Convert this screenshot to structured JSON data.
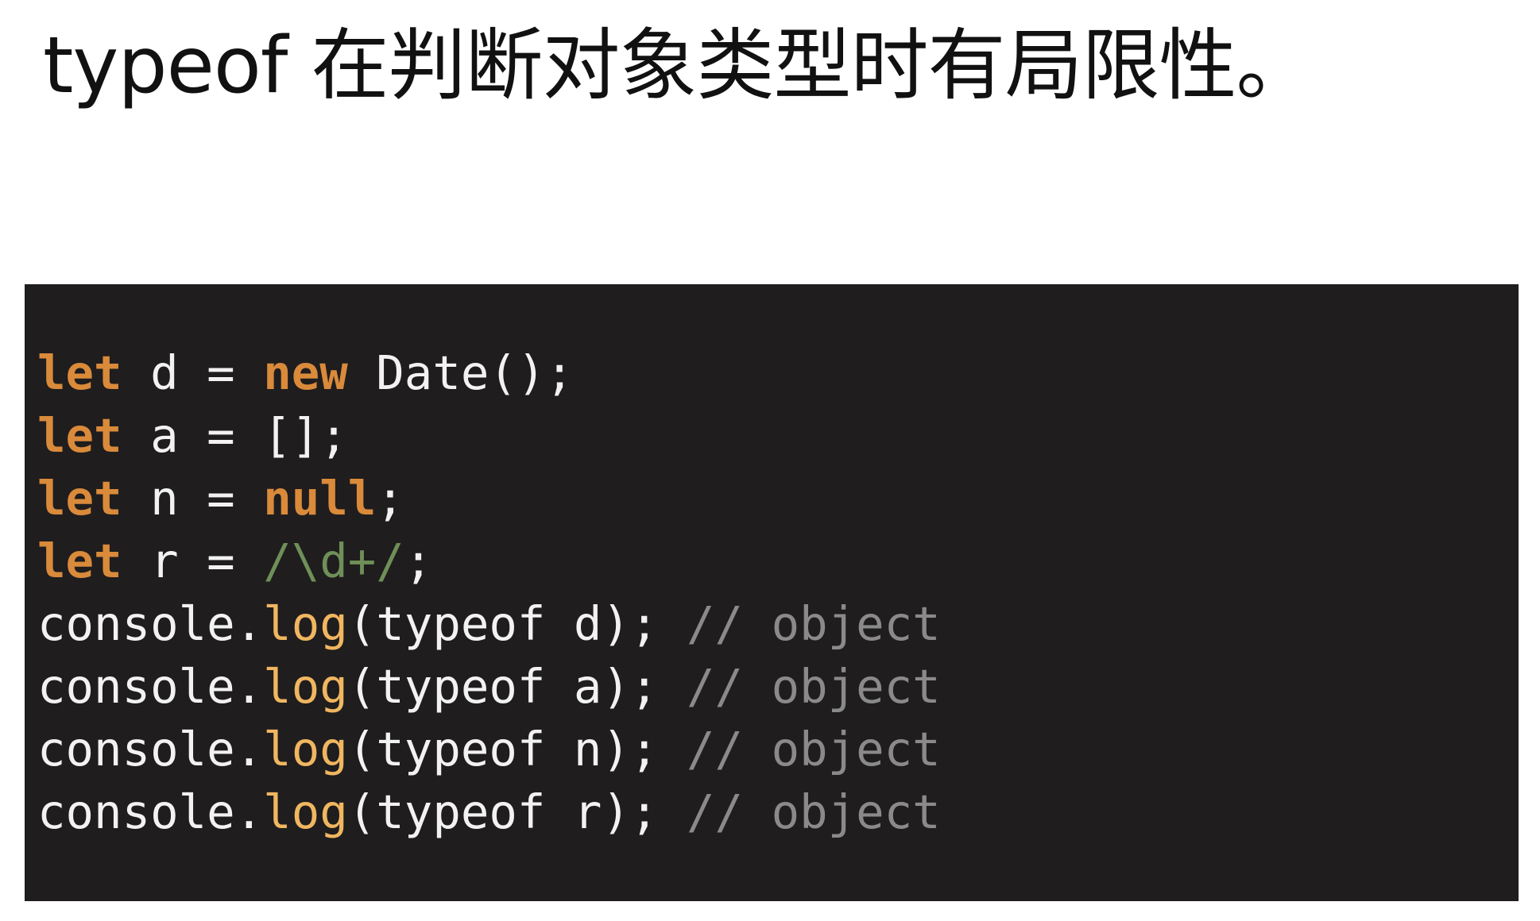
{
  "slide": {
    "title": "typeof 在判断对象类型时有局限性。"
  },
  "colors": {
    "keyword": "#d98a3a",
    "function": "#f0b660",
    "regex": "#6f8f58",
    "comment": "#8a8a8a",
    "code_background": "#1f1d1e"
  },
  "code": {
    "decls": [
      {
        "kw": "let",
        "mid": " d = ",
        "kw2": "new",
        "rest": " Date();"
      },
      {
        "kw": "let",
        "mid": " a = [];"
      },
      {
        "kw": "let",
        "mid": " n = ",
        "kw2": "null",
        "rest": ";"
      },
      {
        "kw": "let",
        "mid": " r = ",
        "regex": "/\\d+/",
        "rest": ";"
      }
    ],
    "logs": [
      {
        "obj": "console.",
        "fn": "log",
        "args": "(typeof d); ",
        "comment": "// object"
      },
      {
        "obj": "console.",
        "fn": "log",
        "args": "(typeof a); ",
        "comment": "// object"
      },
      {
        "obj": "console.",
        "fn": "log",
        "args": "(typeof n); ",
        "comment": "// object"
      },
      {
        "obj": "console.",
        "fn": "log",
        "args": "(typeof r); ",
        "comment": "// object"
      }
    ]
  }
}
